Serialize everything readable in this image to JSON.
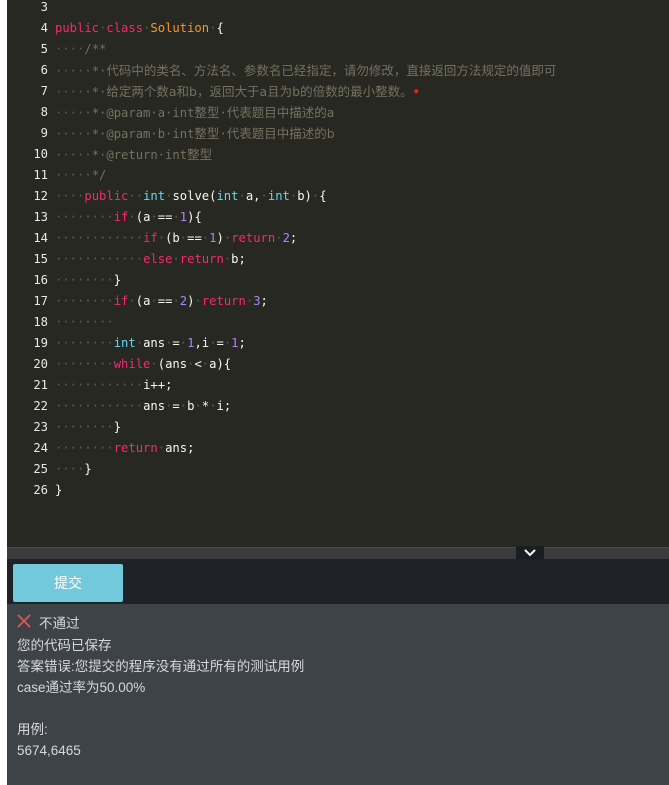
{
  "editor": {
    "lines": [
      {
        "n": "3",
        "segs": []
      },
      {
        "n": "4",
        "segs": [
          [
            "kw",
            "public"
          ],
          [
            "ws",
            "·"
          ],
          [
            "kw",
            "class"
          ],
          [
            "ws",
            "·"
          ],
          [
            "cls",
            "Solution"
          ],
          [
            "ws",
            "·"
          ],
          [
            "p",
            "{"
          ]
        ]
      },
      {
        "n": "5",
        "segs": [
          [
            "ws",
            "····"
          ],
          [
            "cm",
            "/**"
          ]
        ]
      },
      {
        "n": "6",
        "segs": [
          [
            "ws",
            "·····"
          ],
          [
            "cm",
            "*·"
          ],
          [
            "cm-cn",
            "代码中的类名、方法名、参数名已经指定，请勿修改，直接返回方法规定的值即可"
          ]
        ]
      },
      {
        "n": "7",
        "segs": [
          [
            "ws",
            "·····"
          ],
          [
            "cm",
            "*·"
          ],
          [
            "cm-cn",
            "给定两个数a和b，返回大于a且为b的倍数的最小整数。"
          ],
          [
            "err",
            "•"
          ]
        ]
      },
      {
        "n": "8",
        "segs": [
          [
            "ws",
            "·····"
          ],
          [
            "cm",
            "*·@param·a·int"
          ],
          [
            "cm-cn",
            "整型"
          ],
          [
            "cm",
            "·"
          ],
          [
            "cm-cn",
            "代表题目中描述的a"
          ]
        ]
      },
      {
        "n": "9",
        "segs": [
          [
            "ws",
            "·····"
          ],
          [
            "cm",
            "*·@param·b·int"
          ],
          [
            "cm-cn",
            "整型"
          ],
          [
            "cm",
            "·"
          ],
          [
            "cm-cn",
            "代表题目中描述的b"
          ]
        ]
      },
      {
        "n": "10",
        "segs": [
          [
            "ws",
            "·····"
          ],
          [
            "cm",
            "*·@return·int"
          ],
          [
            "cm-cn",
            "整型"
          ]
        ]
      },
      {
        "n": "11",
        "segs": [
          [
            "ws",
            "·····"
          ],
          [
            "cm",
            "*/"
          ]
        ]
      },
      {
        "n": "12",
        "segs": [
          [
            "ws",
            "····"
          ],
          [
            "kw",
            "public"
          ],
          [
            "ws",
            "··"
          ],
          [
            "ty",
            "int"
          ],
          [
            "ws",
            "·"
          ],
          [
            "p",
            "solve("
          ],
          [
            "ty",
            "int"
          ],
          [
            "ws",
            "·"
          ],
          [
            "p",
            "a,"
          ],
          [
            "ws",
            "·"
          ],
          [
            "ty",
            "int"
          ],
          [
            "ws",
            "·"
          ],
          [
            "p",
            "b)"
          ],
          [
            "ws",
            "·"
          ],
          [
            "p",
            "{"
          ]
        ]
      },
      {
        "n": "13",
        "segs": [
          [
            "ws",
            "········"
          ],
          [
            "kw",
            "if"
          ],
          [
            "ws",
            "·"
          ],
          [
            "p",
            "(a"
          ],
          [
            "ws",
            "·"
          ],
          [
            "p",
            "=="
          ],
          [
            "ws",
            "·"
          ],
          [
            "num",
            "1"
          ],
          [
            "p",
            "){"
          ]
        ]
      },
      {
        "n": "14",
        "segs": [
          [
            "ws",
            "············"
          ],
          [
            "kw",
            "if"
          ],
          [
            "ws",
            "·"
          ],
          [
            "p",
            "(b"
          ],
          [
            "ws",
            "·"
          ],
          [
            "p",
            "=="
          ],
          [
            "ws",
            "·"
          ],
          [
            "num",
            "1"
          ],
          [
            "p",
            ")"
          ],
          [
            "ws",
            "·"
          ],
          [
            "kw",
            "return"
          ],
          [
            "ws",
            "·"
          ],
          [
            "num",
            "2"
          ],
          [
            "p",
            ";"
          ]
        ]
      },
      {
        "n": "15",
        "segs": [
          [
            "ws",
            "············"
          ],
          [
            "kw",
            "else"
          ],
          [
            "ws",
            "·"
          ],
          [
            "kw",
            "return"
          ],
          [
            "ws",
            "·"
          ],
          [
            "p",
            "b;"
          ]
        ]
      },
      {
        "n": "16",
        "segs": [
          [
            "ws",
            "········"
          ],
          [
            "p",
            "}"
          ]
        ]
      },
      {
        "n": "17",
        "segs": [
          [
            "ws",
            "········"
          ],
          [
            "kw",
            "if"
          ],
          [
            "ws",
            "·"
          ],
          [
            "p",
            "(a"
          ],
          [
            "ws",
            "·"
          ],
          [
            "p",
            "=="
          ],
          [
            "ws",
            "·"
          ],
          [
            "num",
            "2"
          ],
          [
            "p",
            ")"
          ],
          [
            "ws",
            "·"
          ],
          [
            "kw",
            "return"
          ],
          [
            "ws",
            "·"
          ],
          [
            "num",
            "3"
          ],
          [
            "p",
            ";"
          ]
        ]
      },
      {
        "n": "18",
        "segs": [
          [
            "ws",
            "········"
          ]
        ]
      },
      {
        "n": "19",
        "segs": [
          [
            "ws",
            "········"
          ],
          [
            "ty",
            "int"
          ],
          [
            "ws",
            "·"
          ],
          [
            "p",
            "ans"
          ],
          [
            "ws",
            "·"
          ],
          [
            "p",
            "="
          ],
          [
            "ws",
            "·"
          ],
          [
            "num",
            "1"
          ],
          [
            "p",
            ",i"
          ],
          [
            "ws",
            "·"
          ],
          [
            "p",
            "="
          ],
          [
            "ws",
            "·"
          ],
          [
            "num",
            "1"
          ],
          [
            "p",
            ";"
          ]
        ]
      },
      {
        "n": "20",
        "segs": [
          [
            "ws",
            "········"
          ],
          [
            "kw",
            "while"
          ],
          [
            "ws",
            "·"
          ],
          [
            "p",
            "(ans"
          ],
          [
            "ws",
            "·"
          ],
          [
            "p",
            "<"
          ],
          [
            "ws",
            "·"
          ],
          [
            "p",
            "a){"
          ]
        ]
      },
      {
        "n": "21",
        "segs": [
          [
            "ws",
            "············"
          ],
          [
            "p",
            "i++;"
          ]
        ]
      },
      {
        "n": "22",
        "segs": [
          [
            "ws",
            "············"
          ],
          [
            "p",
            "ans"
          ],
          [
            "ws",
            "·"
          ],
          [
            "p",
            "="
          ],
          [
            "ws",
            "·"
          ],
          [
            "p",
            "b"
          ],
          [
            "ws",
            "·"
          ],
          [
            "p",
            "*"
          ],
          [
            "ws",
            "·"
          ],
          [
            "p",
            "i;"
          ]
        ]
      },
      {
        "n": "23",
        "segs": [
          [
            "ws",
            "········"
          ],
          [
            "p",
            "}"
          ]
        ]
      },
      {
        "n": "24",
        "segs": [
          [
            "ws",
            "········"
          ],
          [
            "kw",
            "return"
          ],
          [
            "ws",
            "·"
          ],
          [
            "p",
            "ans;"
          ]
        ]
      },
      {
        "n": "25",
        "segs": [
          [
            "ws",
            "····"
          ],
          [
            "p",
            "}"
          ]
        ]
      },
      {
        "n": "26",
        "segs": [
          [
            "p",
            "}"
          ]
        ]
      }
    ]
  },
  "toolbar": {
    "submit_label": "提交"
  },
  "result": {
    "status_icon": "close-icon",
    "status_color": "#e05a5a",
    "status_label": "不通过",
    "saved_msg": "您的代码已保存",
    "error_msg": "答案错误:您提交的程序没有通过所有的测试用例",
    "pass_rate": "case通过率为50.00%",
    "case_label": "用例:",
    "case_value": "5674,6465"
  },
  "colors": {
    "editor_bg": "#272822",
    "submit_bg": "#73c9dc",
    "result_bg": "#3e4249"
  }
}
